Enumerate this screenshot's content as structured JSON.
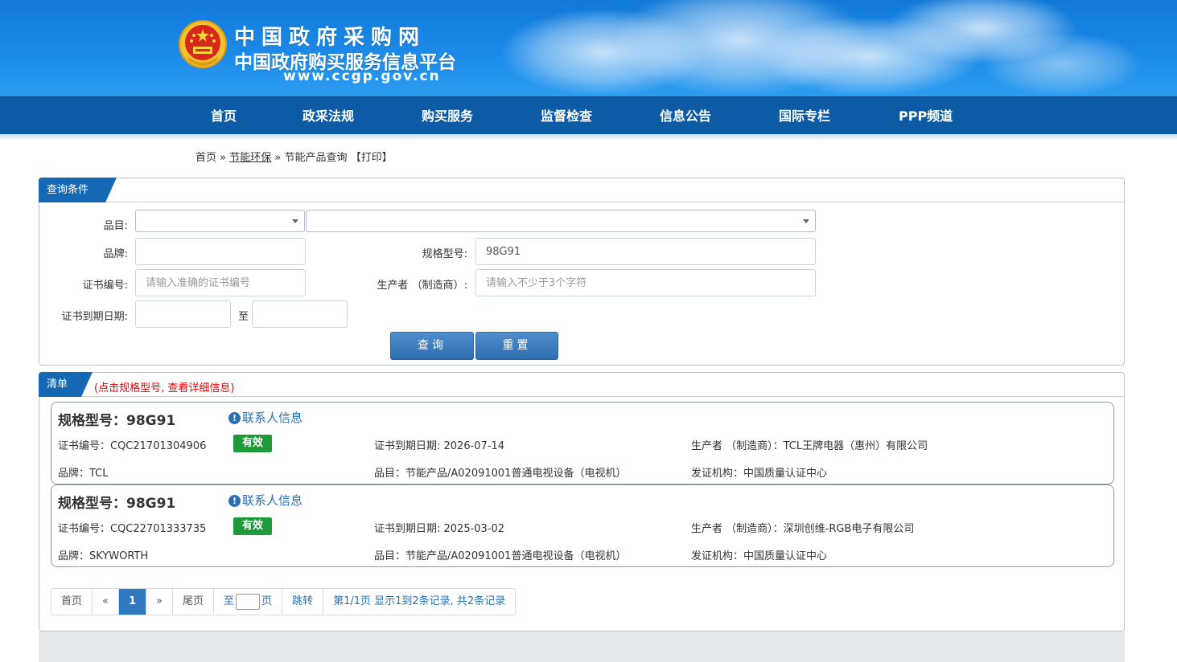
{
  "header": {
    "title": "中国政府采购网",
    "subtitle": "中国政府购买服务信息平台",
    "url": "www.ccgp.gov.cn"
  },
  "nav": {
    "items": [
      "首页",
      "政采法规",
      "购买服务",
      "监督检查",
      "信息公告",
      "国际专栏",
      "PPP频道"
    ]
  },
  "breadcrumb": {
    "home": "首页",
    "sep1": "»",
    "section": "节能环保",
    "sep2": "»",
    "current": "节能产品查询",
    "print": "【打印】"
  },
  "query": {
    "panel_title": "查询条件",
    "category_label": "品目:",
    "brand_label": "品牌:",
    "brand_value": "",
    "model_label": "规格型号:",
    "model_value": "98G91",
    "cert_label": "证书编号:",
    "cert_placeholder": "请输入准确的证书编号",
    "maker_label": "生产者 （制造商）:",
    "maker_placeholder": "请输入不少于3个字符",
    "expiry_label": "证书到期日期:",
    "to_label": "至",
    "search_button": "查询",
    "reset_button": "重置"
  },
  "list": {
    "panel_title": "清单",
    "hint": "(点击规格型号, 查看详细信息)",
    "items": [
      {
        "title": "规格型号：98G91",
        "contact": "联系人信息",
        "cert": "证书编号：CQC21701304906",
        "status": "有效",
        "expiry": "证书到期日期: 2026-07-14",
        "maker": "生产者 （制造商）：TCL王牌电器（惠州）有限公司",
        "brand": "品牌：TCL",
        "category": "品目：节能产品/A02091001普通电视设备（电视机）",
        "issuer": "发证机构：中国质量认证中心"
      },
      {
        "title": "规格型号：98G91",
        "contact": "联系人信息",
        "cert": "证书编号：CQC22701333735",
        "status": "有效",
        "expiry": "证书到期日期: 2025-03-02",
        "maker": "生产者 （制造商）：深圳创维-RGB电子有限公司",
        "brand": "品牌：SKYWORTH",
        "category": "品目：节能产品/A02091001普通电视设备（电视机）",
        "issuer": "发证机构：中国质量认证中心"
      }
    ]
  },
  "pagination": {
    "first": "首页",
    "prev": "«",
    "current": "1",
    "next": "»",
    "last": "尾页",
    "goto_prefix": "至",
    "goto_suffix": "页",
    "jump": "跳转",
    "summary": "第1/1页  显示1到2条记录, 共2条记录"
  },
  "colors": {
    "banner": "#1c8ae8",
    "nav": "#0c5ba4",
    "tab": "#1667b4",
    "valid_badge": "#1e9a3b",
    "hint": "#e00000"
  }
}
